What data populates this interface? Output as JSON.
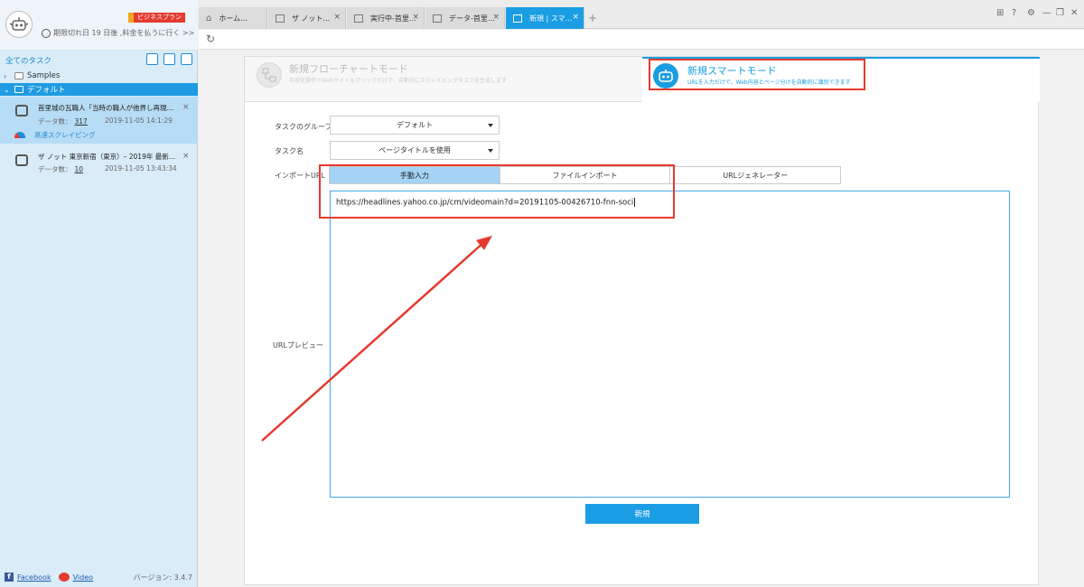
{
  "sidebar": {
    "plan_badge": "ビジネスプラン",
    "expiry_text": "期限切れ日 19 日後 ,料金を払うに行く >>",
    "all_tasks_label": "全てのタスク",
    "tree": [
      {
        "label": "Samples",
        "expanded": false
      },
      {
        "label": "デフォルト",
        "expanded": true
      }
    ],
    "tasks": [
      {
        "title": "首里城の瓦職人「当時の職人が他界し再現…",
        "count_label": "データ数：",
        "count": "317",
        "date": "2019-11-05 14:1:29",
        "speed_label": "高速スクレイピング"
      },
      {
        "title": "ザ ノット 東京新宿（東京）– 2019年 最新…",
        "count_label": "データ数：",
        "count": "10",
        "date": "2019-11-05 13:43:34"
      }
    ],
    "footer": {
      "facebook": "Facebook",
      "video": "Video",
      "version": "バージョン: 3.4.7"
    }
  },
  "tabs": [
    {
      "label": "ホーム…",
      "icon": "home-icon"
    },
    {
      "label": "ザ ノット…",
      "icon": "page-icon"
    },
    {
      "label": "実行中-首里…",
      "icon": "page-icon"
    },
    {
      "label": "データ-首里…",
      "icon": "page-icon"
    },
    {
      "label": "新規 | スマ…",
      "icon": "page-icon",
      "active": true
    }
  ],
  "modes": {
    "flow": {
      "title": "新規フローチャートモード",
      "desc": "可視化操作でWebサイトをクリックだけで、自動的にスクレイピングタスクを生成します"
    },
    "smart": {
      "title": "新規スマートモード",
      "desc": "URLを入力だけで、Web内容とページ分けを自動的に識別できます"
    }
  },
  "form": {
    "group_label": "タスクのグループ",
    "group_value": "デフォルト",
    "name_label": "タスク名",
    "name_value": "ページタイトルを使用",
    "import_label": "インポートURL",
    "url_tabs": [
      "手動入力",
      "ファイルインポート",
      "URLジェネレーター"
    ],
    "preview_label": "URLプレビュー",
    "url_value": "https://headlines.yahoo.co.jp/cm/videomain?d=20191105-00426710-fnn-soci",
    "create_button": "新規"
  },
  "colors": {
    "accent": "#1a9de3",
    "highlight": "#e53a2f"
  }
}
